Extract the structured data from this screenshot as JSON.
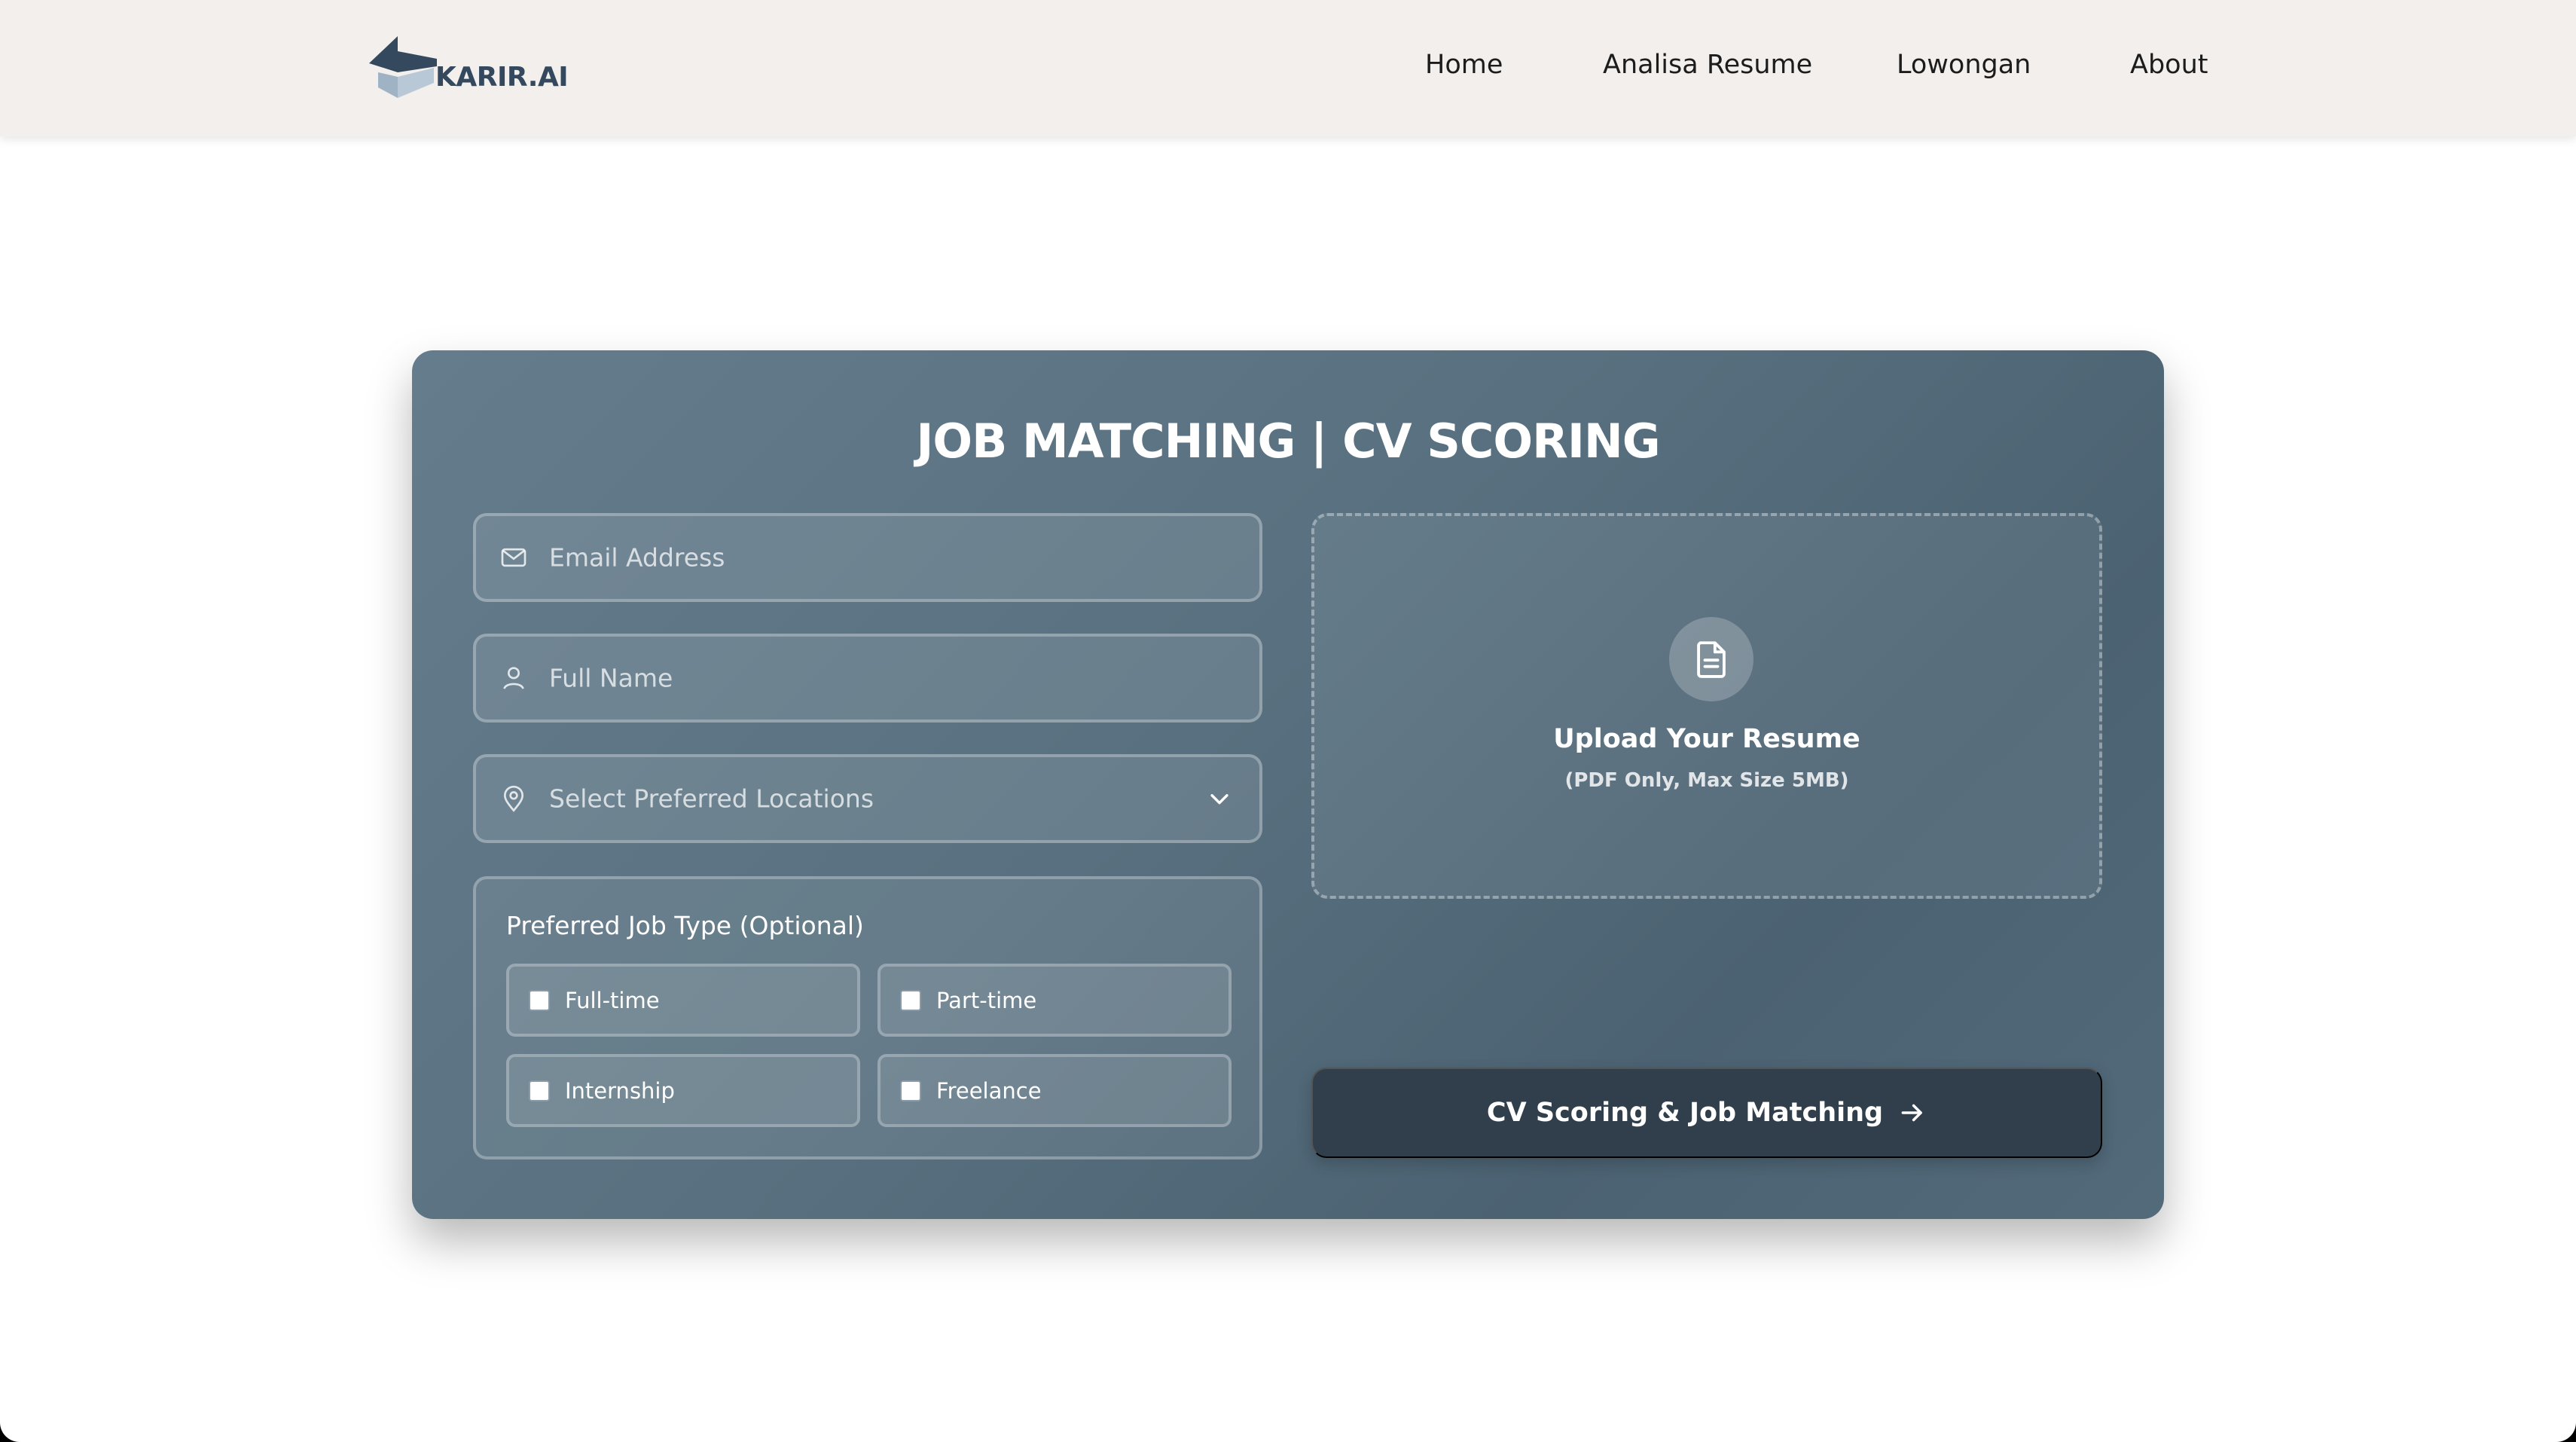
{
  "nav": {
    "brand": "KARIR.AI",
    "links": [
      {
        "label": "Home"
      },
      {
        "label": "Analisa Resume"
      },
      {
        "label": "Lowongan"
      },
      {
        "label": "About"
      }
    ]
  },
  "form": {
    "title": "JOB MATCHING | CV SCORING",
    "email_placeholder": "Email Address",
    "name_placeholder": "Full Name",
    "location_placeholder": "Select Preferred Locations",
    "job_type_title": "Preferred Job Type (Optional)",
    "job_types": [
      {
        "label": "Full-time",
        "checked": false
      },
      {
        "label": "Part-time",
        "checked": false
      },
      {
        "label": "Internship",
        "checked": false
      },
      {
        "label": "Freelance",
        "checked": false
      }
    ]
  },
  "upload": {
    "title": "Upload Your Resume",
    "subtitle": "(PDF Only, Max Size 5MB)",
    "icon": "document-icon"
  },
  "submit": {
    "label": "CV Scoring & Job Matching",
    "icon": "arrow-right-icon"
  },
  "colors": {
    "navbar_bg": "#f2efec",
    "card_bg": "#58707f",
    "button_bg": "#313f4c",
    "brand": "#34495e"
  }
}
